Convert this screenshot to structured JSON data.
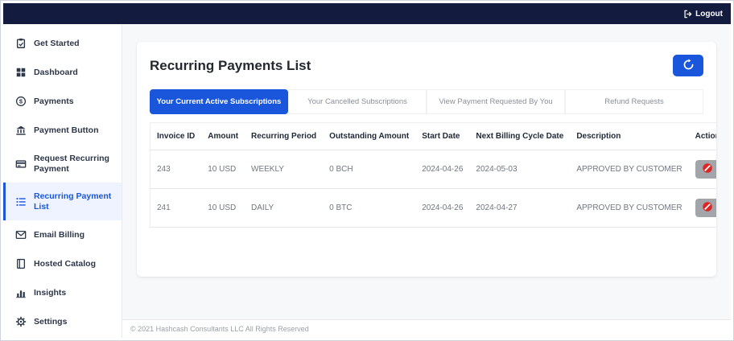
{
  "header": {
    "logout_label": "Logout"
  },
  "sidebar": {
    "items": [
      {
        "label": "Get Started",
        "icon": "get-started-icon",
        "active": false
      },
      {
        "label": "Dashboard",
        "icon": "dashboard-grid-icon",
        "active": false
      },
      {
        "label": "Payments",
        "icon": "dollar-circle-icon",
        "active": false
      },
      {
        "label": "Payment Button",
        "icon": "bank-icon",
        "active": false
      },
      {
        "label": "Request Recurring Payment",
        "icon": "card-request-icon",
        "active": false
      },
      {
        "label": "Recurring Payment List",
        "icon": "list-icon",
        "active": true
      },
      {
        "label": "Email Billing",
        "icon": "email-icon",
        "active": false
      },
      {
        "label": "Hosted Catalog",
        "icon": "catalog-book-icon",
        "active": false
      },
      {
        "label": "Insights",
        "icon": "bar-chart-icon",
        "active": false
      },
      {
        "label": "Settings",
        "icon": "gear-icon",
        "active": false
      }
    ]
  },
  "main": {
    "title": "Recurring Payments List",
    "tabs": [
      {
        "label": "Your Current Active Subscriptions",
        "active": true
      },
      {
        "label": "Your Cancelled Subscriptions",
        "active": false
      },
      {
        "label": "View Payment Requested By You",
        "active": false
      },
      {
        "label": "Refund Requests",
        "active": false
      }
    ],
    "table": {
      "columns": [
        "Invoice ID",
        "Amount",
        "Recurring Period",
        "Outstanding Amount",
        "Start Date",
        "Next Billing Cycle Date",
        "Description",
        "Action"
      ],
      "rows": [
        {
          "invoice_id": "243",
          "amount": "10 USD",
          "recurring_period": "WEEKLY",
          "outstanding_amount": "0 BCH",
          "start_date": "2024-04-26",
          "next_billing_cycle_date": "2024-05-03",
          "description": "APPROVED BY CUSTOMER"
        },
        {
          "invoice_id": "241",
          "amount": "10 USD",
          "recurring_period": "DAILY",
          "outstanding_amount": "0 BTC",
          "start_date": "2024-04-26",
          "next_billing_cycle_date": "2024-04-27",
          "description": "APPROVED BY CUSTOMER"
        }
      ]
    }
  },
  "footer": {
    "copyright": "© 2021 Hashcash Consultants LLC All Rights Reserved"
  },
  "colors": {
    "header_navy": "#131c3e",
    "accent_blue": "#1a56db",
    "action_red": "#dc2626",
    "action_button_gray": "#a2a6ab"
  }
}
